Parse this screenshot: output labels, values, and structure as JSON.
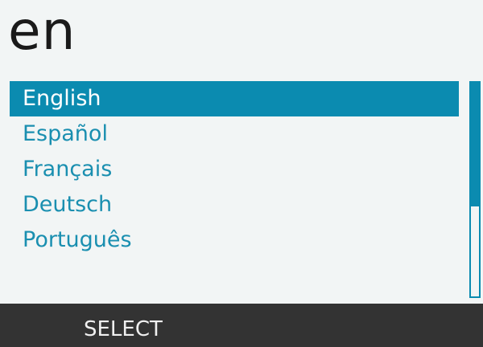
{
  "header": {
    "language_code": "en"
  },
  "language_list": {
    "items": [
      {
        "label": "English",
        "selected": true
      },
      {
        "label": "Español",
        "selected": false
      },
      {
        "label": "Français",
        "selected": false
      },
      {
        "label": "Deutsch",
        "selected": false
      },
      {
        "label": "Português",
        "selected": false
      }
    ]
  },
  "scrollbar": {
    "visible_fraction": 0.58
  },
  "softkeys": {
    "left_label": "SELECT"
  },
  "colors": {
    "accent": "#0b8bb0",
    "item_text": "#1a8fb0",
    "selected_text": "#ffffff",
    "background": "#f2f5f5",
    "softkey_bar": "#333333"
  }
}
